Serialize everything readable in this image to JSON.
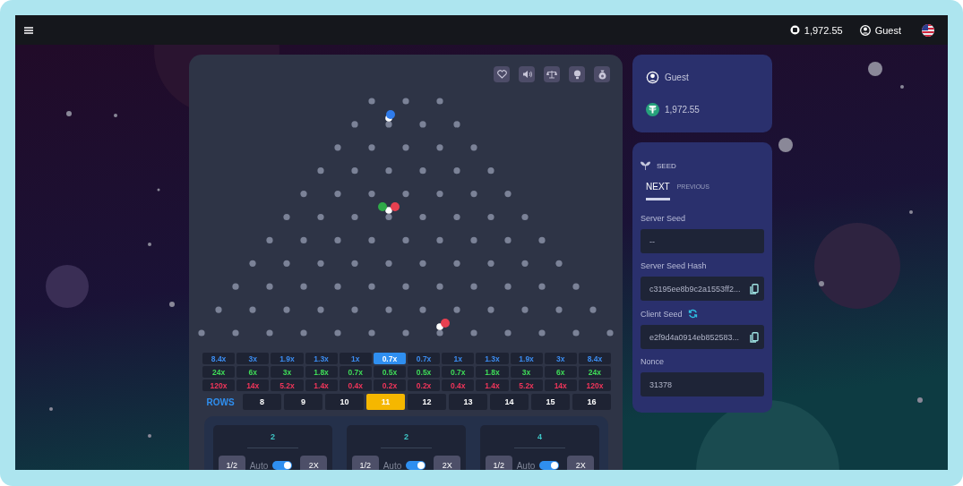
{
  "top_bar": {
    "balance": "1,972.55",
    "user": "Guest"
  },
  "multiplier_rows": [
    {
      "color": "#3b8cf0",
      "cells": [
        {
          "label": "8.4x",
          "selected": false
        },
        {
          "label": "3x",
          "selected": false
        },
        {
          "label": "1.9x",
          "selected": false
        },
        {
          "label": "1.3x",
          "selected": false
        },
        {
          "label": "1x",
          "selected": false
        },
        {
          "label": "0.7x",
          "selected": true
        },
        {
          "label": "0.7x",
          "selected": false
        },
        {
          "label": "1x",
          "selected": false
        },
        {
          "label": "1.3x",
          "selected": false
        },
        {
          "label": "1.9x",
          "selected": false
        },
        {
          "label": "3x",
          "selected": false
        },
        {
          "label": "8.4x",
          "selected": false
        }
      ]
    },
    {
      "color": "#3fdc58",
      "cells": [
        {
          "label": "24x",
          "selected": false
        },
        {
          "label": "6x",
          "selected": false
        },
        {
          "label": "3x",
          "selected": false
        },
        {
          "label": "1.8x",
          "selected": false
        },
        {
          "label": "0.7x",
          "selected": false
        },
        {
          "label": "0.5x",
          "selected": false
        },
        {
          "label": "0.5x",
          "selected": false
        },
        {
          "label": "0.7x",
          "selected": false
        },
        {
          "label": "1.8x",
          "selected": false
        },
        {
          "label": "3x",
          "selected": false
        },
        {
          "label": "6x",
          "selected": false
        },
        {
          "label": "24x",
          "selected": false
        }
      ]
    },
    {
      "color": "#f0355a",
      "cells": [
        {
          "label": "120x",
          "selected": false
        },
        {
          "label": "14x",
          "selected": false
        },
        {
          "label": "5.2x",
          "selected": false
        },
        {
          "label": "1.4x",
          "selected": false
        },
        {
          "label": "0.4x",
          "selected": false
        },
        {
          "label": "0.2x",
          "selected": false
        },
        {
          "label": "0.2x",
          "selected": false
        },
        {
          "label": "0.4x",
          "selected": false
        },
        {
          "label": "1.4x",
          "selected": false
        },
        {
          "label": "5.2x",
          "selected": false
        },
        {
          "label": "14x",
          "selected": false
        },
        {
          "label": "120x",
          "selected": false
        }
      ]
    }
  ],
  "rows_selector": {
    "label": "ROWS",
    "options": [
      {
        "label": "8",
        "selected": false
      },
      {
        "label": "9",
        "selected": false
      },
      {
        "label": "10",
        "selected": false
      },
      {
        "label": "11",
        "selected": true
      },
      {
        "label": "12",
        "selected": false
      },
      {
        "label": "13",
        "selected": false
      },
      {
        "label": "14",
        "selected": false
      },
      {
        "label": "15",
        "selected": false
      },
      {
        "label": "16",
        "selected": false
      }
    ]
  },
  "bets": [
    {
      "value": "2",
      "half": "1/2",
      "auto_label": "Auto",
      "auto_on": true,
      "double": "2X"
    },
    {
      "value": "2",
      "half": "1/2",
      "auto_label": "Auto",
      "auto_on": true,
      "double": "2X"
    },
    {
      "value": "4",
      "half": "1/2",
      "auto_label": "Auto",
      "auto_on": true,
      "double": "2X"
    }
  ],
  "profile": {
    "user": "Guest",
    "balance": "1,972.55"
  },
  "seed": {
    "title": "SEED",
    "tabs": [
      {
        "label": "NEXT",
        "selected": true
      },
      {
        "label": "PREVIOUS",
        "selected": false
      }
    ],
    "fields": [
      {
        "label": "Server Seed",
        "value": "--",
        "copyable": false,
        "refreshable": false
      },
      {
        "label": "Server Seed Hash",
        "value": "c3195ee8b9c2a1553ff2...",
        "copyable": true,
        "refreshable": false
      },
      {
        "label": "Client Seed",
        "value": "e2f9d4a0914eb852583...",
        "copyable": true,
        "refreshable": true
      },
      {
        "label": "Nonce",
        "value": "31378",
        "copyable": false,
        "refreshable": false
      }
    ]
  }
}
